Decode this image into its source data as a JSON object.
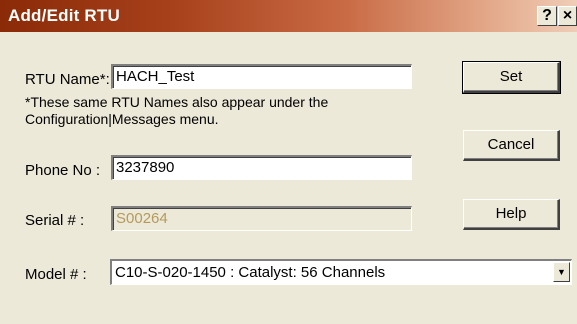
{
  "window": {
    "title": "Add/Edit RTU",
    "help_glyph": "?",
    "close_glyph": "×"
  },
  "form": {
    "rtu_name_label": "RTU Name*:",
    "rtu_name_value": "HACH_Test",
    "note_line1": "*These same RTU Names also appear under the",
    "note_line2": "Configuration|Messages menu.",
    "phone_label": "Phone No :",
    "phone_value": "3237890",
    "serial_label": "Serial # :",
    "serial_value": "S00264",
    "model_label": "Model # :",
    "model_value": "C10-S-020-1450 : Catalyst: 56 Channels"
  },
  "buttons": {
    "set": "Set",
    "cancel": "Cancel",
    "help": "Help"
  },
  "icons": {
    "dropdown": "chevron-down-icon",
    "dropdown_glyph": "▼"
  }
}
